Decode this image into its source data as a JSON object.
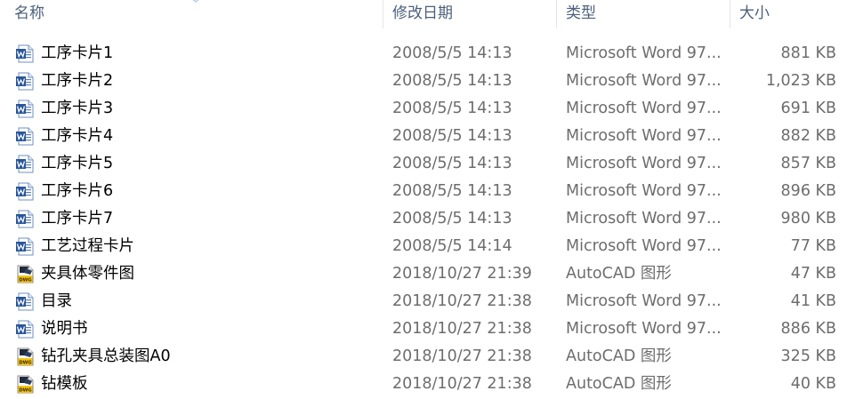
{
  "columns": {
    "name": "名称",
    "date": "修改日期",
    "type": "类型",
    "size": "大小"
  },
  "colors": {
    "header_text": "#4c607a",
    "secondary_text": "#6d6d6d",
    "word_icon_blue": "#2a5699",
    "dwg_icon_yellow": "#f5c518"
  },
  "files": [
    {
      "name": "工序卡片1",
      "date": "2008/5/5 14:13",
      "type": "Microsoft Word 97...",
      "size": "881 KB",
      "icon": "word-doc-icon"
    },
    {
      "name": "工序卡片2",
      "date": "2008/5/5 14:13",
      "type": "Microsoft Word 97...",
      "size": "1,023 KB",
      "icon": "word-doc-icon"
    },
    {
      "name": "工序卡片3",
      "date": "2008/5/5 14:13",
      "type": "Microsoft Word 97...",
      "size": "691 KB",
      "icon": "word-doc-icon"
    },
    {
      "name": "工序卡片4",
      "date": "2008/5/5 14:13",
      "type": "Microsoft Word 97...",
      "size": "882 KB",
      "icon": "word-doc-icon"
    },
    {
      "name": "工序卡片5",
      "date": "2008/5/5 14:13",
      "type": "Microsoft Word 97...",
      "size": "857 KB",
      "icon": "word-doc-icon"
    },
    {
      "name": "工序卡片6",
      "date": "2008/5/5 14:13",
      "type": "Microsoft Word 97...",
      "size": "896 KB",
      "icon": "word-doc-icon"
    },
    {
      "name": "工序卡片7",
      "date": "2008/5/5 14:13",
      "type": "Microsoft Word 97...",
      "size": "980 KB",
      "icon": "word-doc-icon"
    },
    {
      "name": "工艺过程卡片",
      "date": "2008/5/5 14:14",
      "type": "Microsoft Word 97...",
      "size": "77 KB",
      "icon": "word-doc-icon"
    },
    {
      "name": "夹具体零件图",
      "date": "2018/10/27 21:39",
      "type": "AutoCAD 图形",
      "size": "47 KB",
      "icon": "dwg-file-icon"
    },
    {
      "name": "目录",
      "date": "2018/10/27 21:38",
      "type": "Microsoft Word 97...",
      "size": "41 KB",
      "icon": "word-doc-icon"
    },
    {
      "name": "说明书",
      "date": "2018/10/27 21:38",
      "type": "Microsoft Word 97...",
      "size": "886 KB",
      "icon": "word-doc-icon"
    },
    {
      "name": "钻孔夹具总装图A0",
      "date": "2018/10/27 21:38",
      "type": "AutoCAD 图形",
      "size": "325 KB",
      "icon": "dwg-file-icon"
    },
    {
      "name": "钻模板",
      "date": "2018/10/27 21:38",
      "type": "AutoCAD 图形",
      "size": "40 KB",
      "icon": "dwg-file-icon"
    }
  ]
}
